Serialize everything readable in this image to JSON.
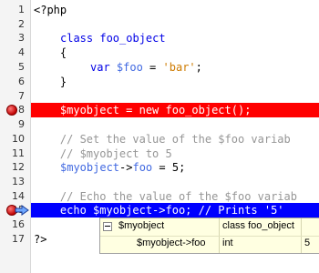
{
  "editor": {
    "lines": [
      {
        "num": "1",
        "text": "<?php"
      },
      {
        "num": "2",
        "text": ""
      },
      {
        "num": "3",
        "kw": "class",
        "rest": " foo_object"
      },
      {
        "num": "4",
        "text": "    {"
      },
      {
        "num": "5",
        "kw": "var",
        "var": "$foo",
        "mid": " = ",
        "str": "'bar'",
        "end": ";"
      },
      {
        "num": "6",
        "text": "    }"
      },
      {
        "num": "7",
        "text": ""
      },
      {
        "num": "8",
        "text": "    $myobject = new foo_object();"
      },
      {
        "num": "9",
        "text": ""
      },
      {
        "num": "10",
        "comment": "    // Set the value of the $foo variab"
      },
      {
        "num": "11",
        "comment": "    // $myobject to 5"
      },
      {
        "num": "12",
        "var": "$myobject",
        "mid": "->",
        "var2": "foo",
        "end": " = 5;"
      },
      {
        "num": "13",
        "text": ""
      },
      {
        "num": "14",
        "comment": "    // Echo the value of the $foo variab"
      },
      {
        "num": "15",
        "text": "    echo $myobject->foo; // Prints '5'"
      },
      {
        "num": "16",
        "text": ""
      },
      {
        "num": "17",
        "text": "?>"
      }
    ]
  },
  "tooltip": {
    "row1": {
      "name": "$myobject",
      "type": "class foo_object",
      "value": ""
    },
    "row2": {
      "name": "$myobject->foo",
      "type": "int",
      "value": "5"
    }
  },
  "colors": {
    "breakpoint": "#ff0000",
    "current_line": "#0000ff"
  }
}
